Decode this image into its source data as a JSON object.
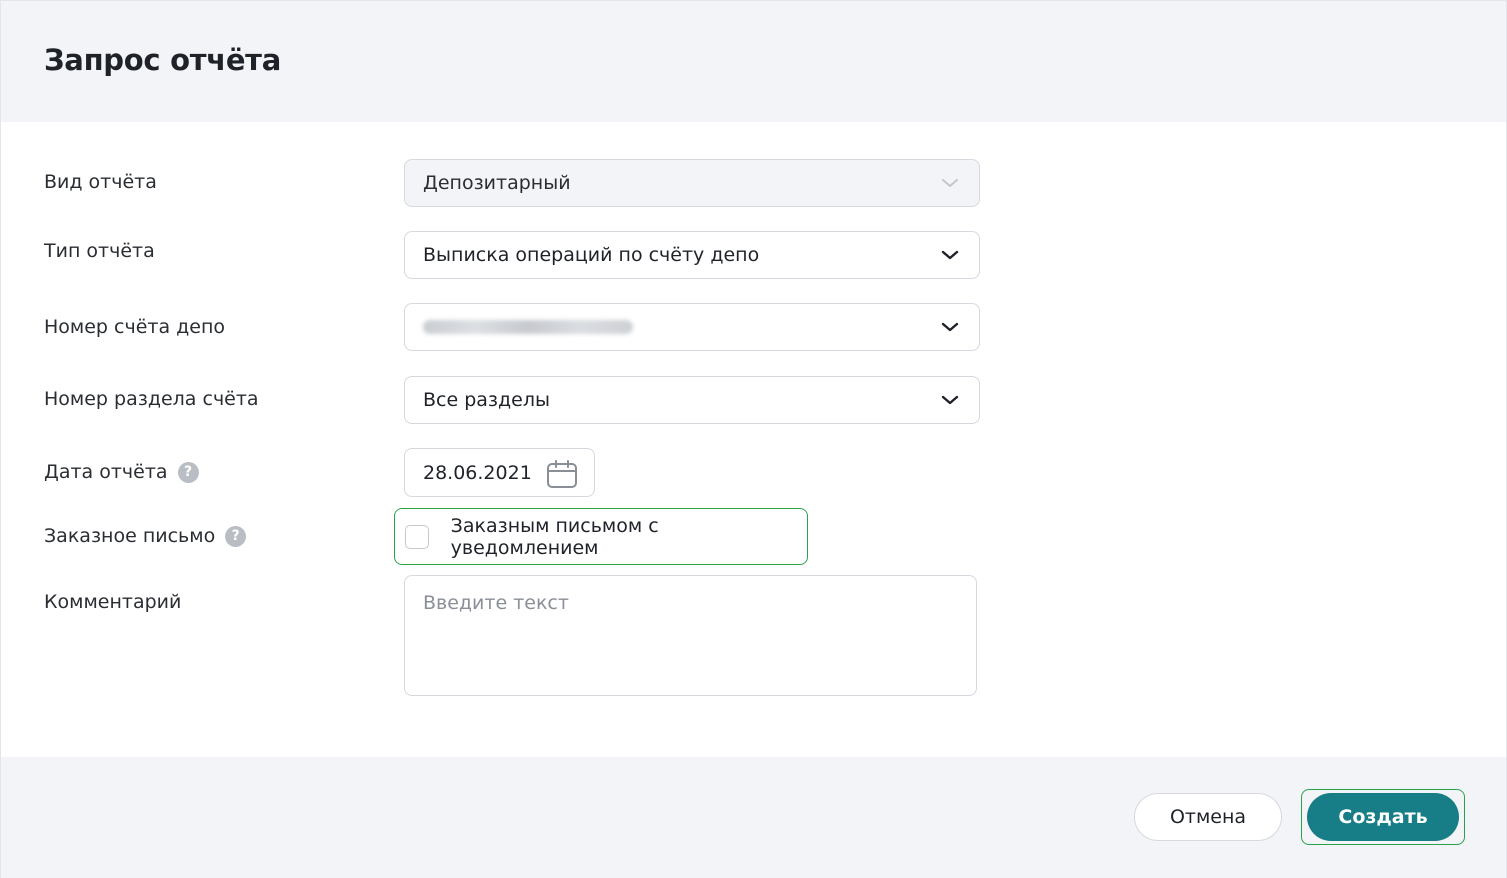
{
  "dialog": {
    "title": "Запрос отчёта"
  },
  "form": {
    "report_kind": {
      "label": "Вид отчёта",
      "value": "Депозитарный"
    },
    "report_type": {
      "label": "Тип отчёта",
      "value": "Выписка операций по счёту депо"
    },
    "depo_account": {
      "label": "Номер счёта депо",
      "value": ""
    },
    "account_section": {
      "label": "Номер раздела счёта",
      "value": "Все разделы"
    },
    "report_date": {
      "label": "Дата отчёта",
      "value": "28.06.2021"
    },
    "registered_mail": {
      "label": "Заказное письмо",
      "checkbox_label": "Заказным письмом с уведомлением",
      "checked": false
    },
    "comment": {
      "label": "Комментарий",
      "placeholder": "Введите текст"
    }
  },
  "footer": {
    "cancel_label": "Отмена",
    "create_label": "Создать"
  },
  "colors": {
    "primary": "#177d86",
    "focus_outline": "#2aa14d",
    "header_bg": "#f3f4f7"
  }
}
